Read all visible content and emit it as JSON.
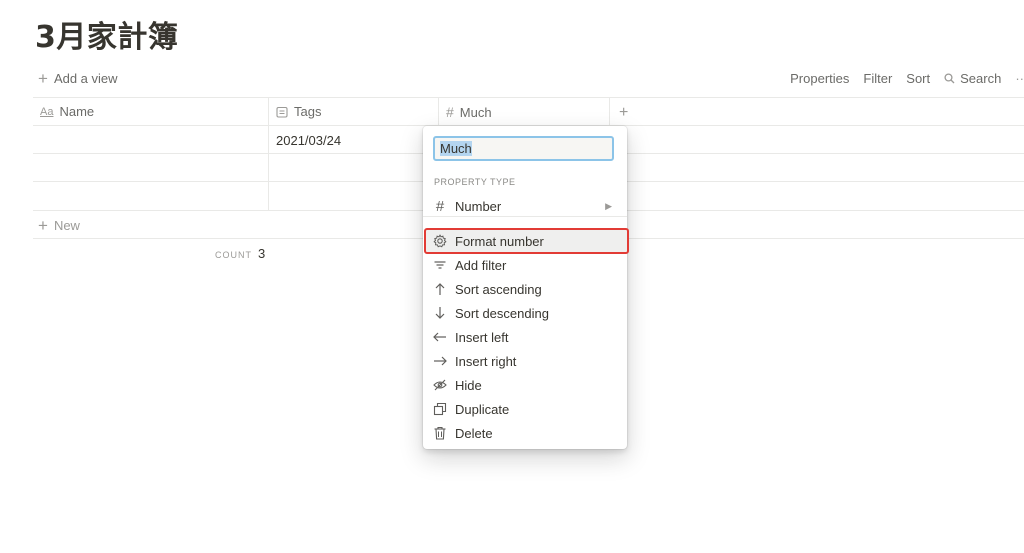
{
  "page": {
    "title": "3月家計簿"
  },
  "view_bar": {
    "add_view": "Add a view",
    "properties": "Properties",
    "filter": "Filter",
    "sort": "Sort",
    "search": "Search",
    "more": "··"
  },
  "table": {
    "columns": [
      {
        "label": "Name",
        "icon": "text-aa-icon"
      },
      {
        "label": "Tags",
        "icon": "calendar-icon"
      },
      {
        "label": "Much",
        "icon": "hash-icon"
      }
    ],
    "add_column": "+",
    "rows": [
      {
        "name": "",
        "tags": "2021/03/24",
        "much": ""
      },
      {
        "name": "",
        "tags": "",
        "much": ""
      },
      {
        "name": "",
        "tags": "",
        "much": ""
      }
    ],
    "new_row": "New",
    "count_label": "COUNT",
    "count_value": "3"
  },
  "property_menu": {
    "name_value": "Much",
    "section_label": "PROPERTY TYPE",
    "type_label": "Number",
    "items": [
      {
        "label": "Format number",
        "icon": "gear-icon",
        "highlighted": true
      },
      {
        "label": "Add filter",
        "icon": "filter-icon"
      },
      {
        "label": "Sort ascending",
        "icon": "arrow-up-icon"
      },
      {
        "label": "Sort descending",
        "icon": "arrow-down-icon"
      },
      {
        "label": "Insert left",
        "icon": "arrow-left-icon"
      },
      {
        "label": "Insert right",
        "icon": "arrow-right-icon"
      },
      {
        "label": "Hide",
        "icon": "eye-off-icon"
      },
      {
        "label": "Duplicate",
        "icon": "duplicate-icon"
      },
      {
        "label": "Delete",
        "icon": "trash-icon"
      }
    ]
  },
  "colors": {
    "highlight_outline": "#e23b35",
    "input_focus": "#8cc4e8",
    "text": "#37352f",
    "muted": "#9b9a97"
  }
}
